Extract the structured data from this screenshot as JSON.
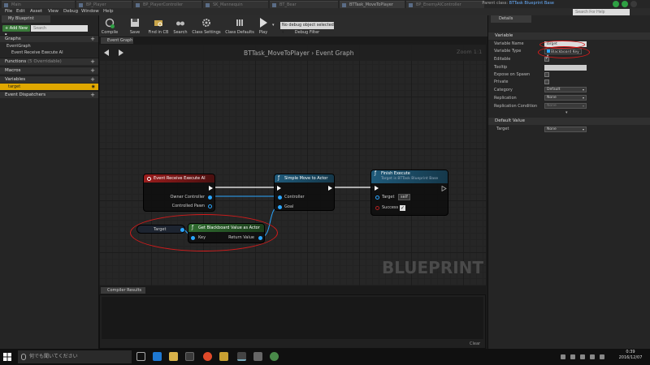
{
  "window": {
    "tabs": [
      "Main",
      "BP_Player",
      "BP_PlayerController",
      "SK_Mannequin",
      "BT_Bear",
      "BTTask_MoveToPlayer",
      "BP_EnemyAIController"
    ],
    "active_tab": "BTTask_MoveToPlayer",
    "parent_class_label": "Parent class:",
    "parent_class_value": "BTTask Blueprint Base",
    "help_search_placeholder": "Search For Help"
  },
  "menu": [
    "File",
    "Edit",
    "Asset",
    "View",
    "Debug",
    "Window",
    "Help"
  ],
  "toolbar": {
    "compile": "Compile",
    "save": "Save",
    "find_in_cb": "Find in CB",
    "search": "Search",
    "class_settings": "Class Settings",
    "class_defaults": "Class Defaults",
    "play": "Play",
    "debug_select": "No debug object selected ▾",
    "debug_filter": "Debug Filter"
  },
  "my_blueprint": {
    "tab_label": "My Blueprint",
    "add_new": "+ Add New ▾",
    "search_placeholder": "Search",
    "graphs_label": "Graphs",
    "event_graph": "EventGraph",
    "event_receive": "Event Receive Execute AI",
    "functions_label": "Functions",
    "functions_count": "(5 Overridable)",
    "macros_label": "Macros",
    "variables_label": "Variables",
    "variable_target": "target",
    "event_dispatchers_label": "Event Dispatchers"
  },
  "graph": {
    "tab_label": "Event Graph",
    "title": "BTTask_MoveToPlayer › Event Graph",
    "zoom": "Zoom 1:1",
    "watermark": "BLUEPRINT",
    "nodes": {
      "event_receive": {
        "title": "Event Receive Execute AI",
        "pin_owner": "Owner Controller",
        "pin_pawn": "Controlled Pawn"
      },
      "simple_move": {
        "title": "Simple Move to Actor",
        "pin_controller": "Controller",
        "pin_goal": "Goal"
      },
      "finish_execute": {
        "title": "Finish Execute",
        "subtitle": "Target is BTTask Blueprint Base",
        "pin_target": "Target",
        "pin_target_value": "self",
        "pin_success": "Success"
      },
      "target_var": {
        "label": "Target"
      },
      "get_bb_value": {
        "title": "Get Blackboard Value as Actor",
        "pin_key": "Key",
        "pin_return": "Return Value"
      }
    }
  },
  "compile_results": {
    "tab_label": "Compiler Results",
    "clear": "Clear"
  },
  "details": {
    "tab_label": "Details",
    "variable_section": "Variable",
    "rows": {
      "variable_name": {
        "label": "Variable Name",
        "value": "Target"
      },
      "variable_type": {
        "label": "Variable Type",
        "value": "Blackboard Key ▾"
      },
      "editable": {
        "label": "Editable",
        "checked": true
      },
      "tooltip": {
        "label": "Tooltip",
        "value": ""
      },
      "expose_on_spawn": {
        "label": "Expose on Spawn",
        "checked": false
      },
      "private": {
        "label": "Private",
        "checked": false
      },
      "category": {
        "label": "Category",
        "value": "Default"
      },
      "replication": {
        "label": "Replication",
        "value": "None"
      },
      "replication_condition": {
        "label": "Replication Condition",
        "value": "None"
      }
    },
    "default_value_section": "Default Value",
    "default_target": {
      "label": "Target",
      "value": "None"
    }
  },
  "taskbar": {
    "search_placeholder": "何でも聞いてください",
    "time": "0:39",
    "date": "2016/12/07"
  },
  "colors": {
    "accent_selected": "#e0a800",
    "pin_object": "#2aa6ff",
    "annotation": "#d41b1b",
    "event_header": "#9b1c1c",
    "function_header": "#1f5a7a",
    "pure_header": "#2f6b2f"
  }
}
